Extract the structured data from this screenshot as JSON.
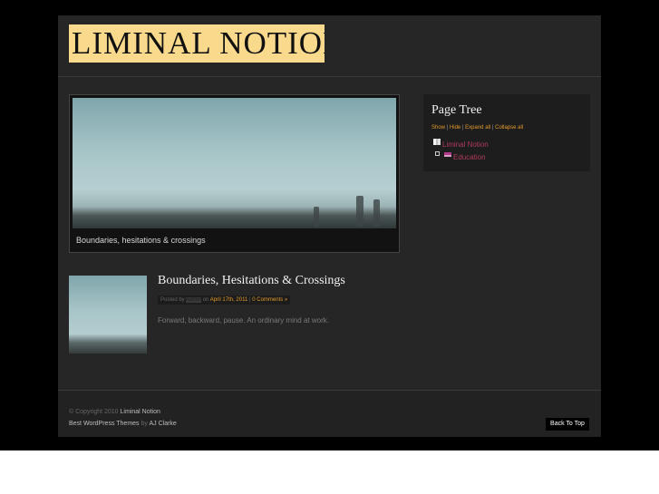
{
  "site": {
    "logo_text": "LIMINAL NOTION",
    "brand_color": "#f9d98c",
    "accent_color": "#e39a2b",
    "link_color": "#b03a5b"
  },
  "featured": {
    "caption": "Boundaries, hesitations & crossings"
  },
  "sidebar": {
    "widget_title": "Page Tree",
    "controls": {
      "show": "Show",
      "hide": "Hide",
      "expand_all": "Expand all",
      "collapse_all": "Collapse all",
      "separator": " | "
    },
    "tree": [
      {
        "label": "Liminal Notion",
        "icon": "book-icon"
      },
      {
        "label": "Education",
        "icon": "book-icon",
        "toggle_icon": "minus-icon"
      }
    ]
  },
  "post": {
    "title": "Boundaries, Hesitations & Crossings",
    "posted_by_prefix": "Posted by",
    "author": "Admin",
    "on_text": "on",
    "date": "April 17th, 2011",
    "separator": "|",
    "comments": "0 Comments »",
    "excerpt": "Forward, backward, pause.  An ordinary mind at work."
  },
  "footer": {
    "copyright_prefix": "© Copyright 2010",
    "copyright_site": "Liminal Notion",
    "themes_text": "Best WordPress Themes",
    "by_text": "by",
    "author_name": "AJ Clarke",
    "back_to_top": "Back To Top"
  }
}
